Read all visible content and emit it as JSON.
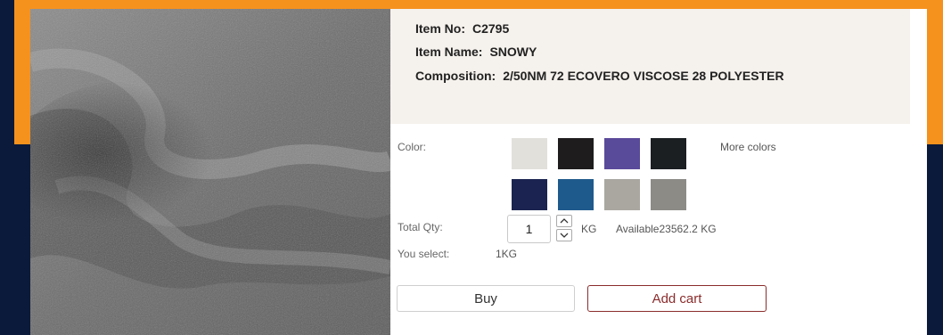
{
  "product": {
    "item_no_label": "Item No:",
    "item_no": "C2795",
    "item_name_label": "Item Name:",
    "item_name": "SNOWY",
    "composition_label": "Composition:",
    "composition": "2/50NM 72 ECOVERO VISCOSE 28 POLYESTER"
  },
  "color": {
    "label": "Color:",
    "more_colors": "More colors",
    "swatches": [
      "#e2e0da",
      "#1e1c1d",
      "#5a4a9a",
      "#1b1f22",
      "#1b2450",
      "#1f5a8c",
      "#a9a7a0",
      "#8c8b86"
    ]
  },
  "qty": {
    "label": "Total Qty:",
    "value": "1",
    "unit": "KG",
    "available": "Available23562.2",
    "available_unit": "KG"
  },
  "selection": {
    "label": "You select:",
    "value": "1KG"
  },
  "buttons": {
    "buy": "Buy",
    "add_cart": "Add cart"
  },
  "colors": {
    "accent_orange": "#f5921e",
    "background_navy": "#0b1a3b",
    "cart_button": "#8b2c2c"
  }
}
